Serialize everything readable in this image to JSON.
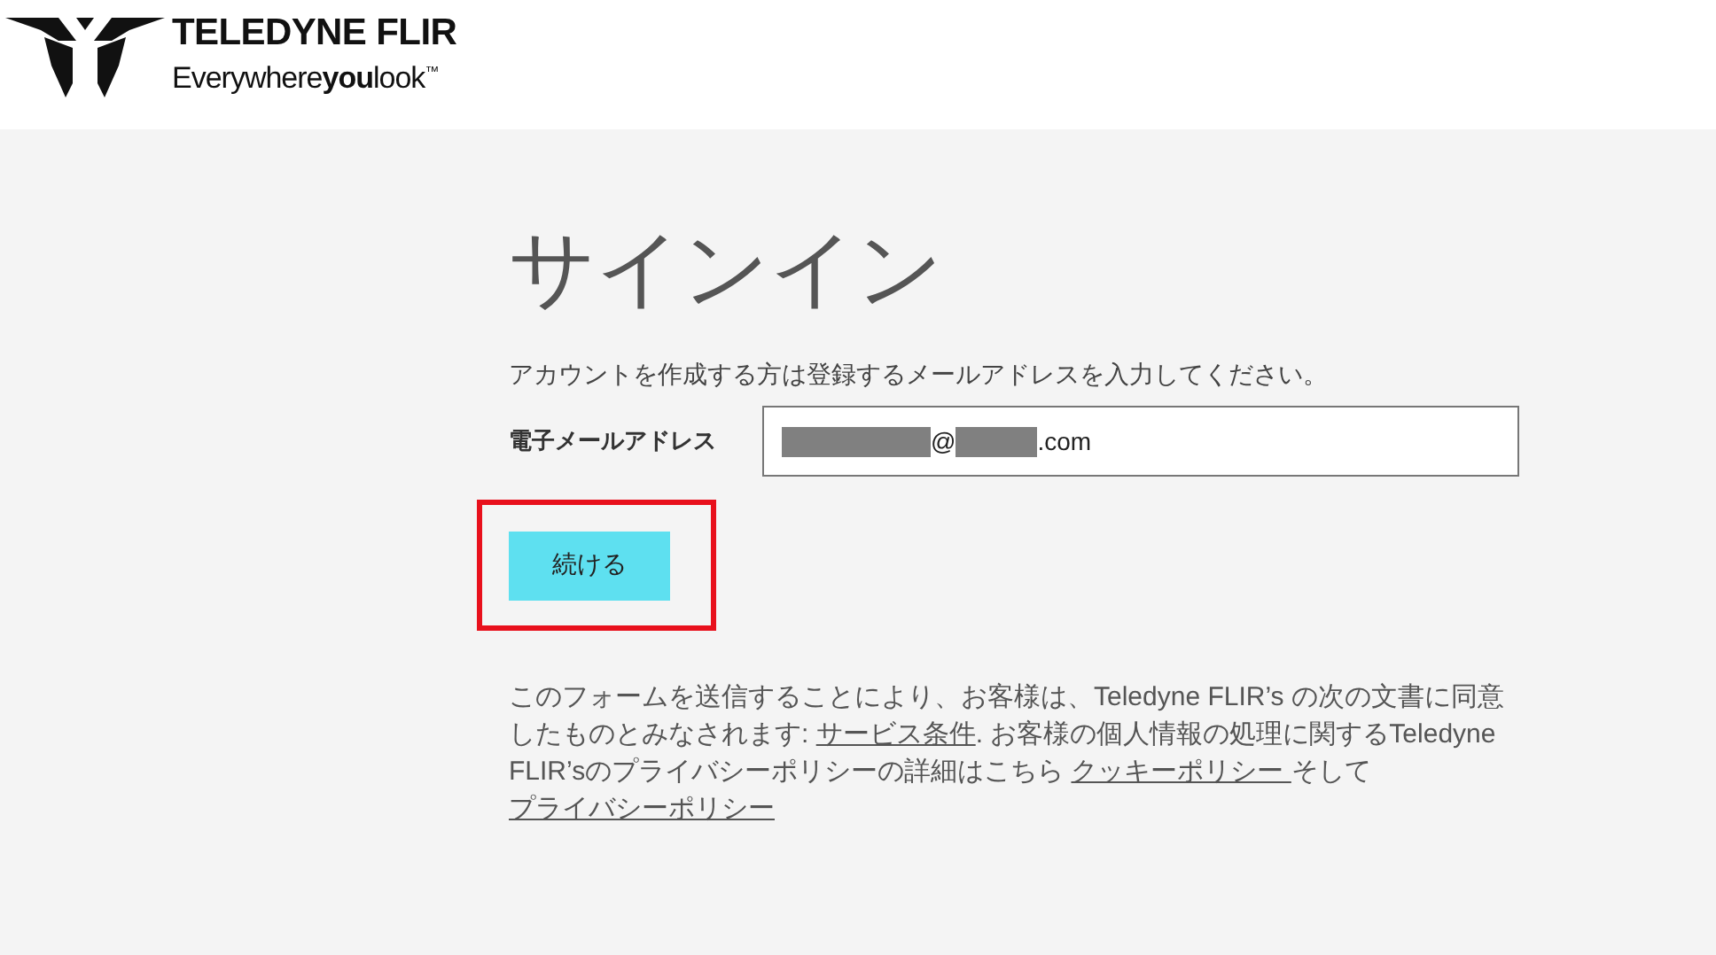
{
  "header": {
    "brand": "TELEDYNE FLIR",
    "tagline": "Everywhere**you**look$^{™}$"
  },
  "title": "サインイン",
  "instruction": "アカウントを作成する方は登録するメールアドレスを入力してください。",
  "email_field": {
    "label": "電子メールアドレス",
    "value_parts": [
      {
        "kind": "redacted-long"
      },
      {
        "kind": "text",
        "text": "@"
      },
      {
        "kind": "redacted-short"
      },
      {
        "kind": "text",
        "text": ".com"
      }
    ]
  },
  "continue_button": {
    "label": "続ける",
    "highlighted": true
  },
  "legal": [
    {
      "kind": "text",
      "text": "このフォームを送信することにより、お客様は、Teledyne FLIR’s の次の文書に同意したものとみなされます: "
    },
    {
      "kind": "link",
      "text": "サービス条件"
    },
    {
      "kind": "text",
      "text": ". お客様の個人情報の処理に関するTeledyne FLIR’sのプライバシーポリシーの詳細はこちら "
    },
    {
      "kind": "link",
      "text": "クッキーポリシー "
    },
    {
      "kind": "text",
      "text": " そして "
    },
    {
      "kind": "link",
      "text": "プライバシーポリシー"
    }
  ]
}
